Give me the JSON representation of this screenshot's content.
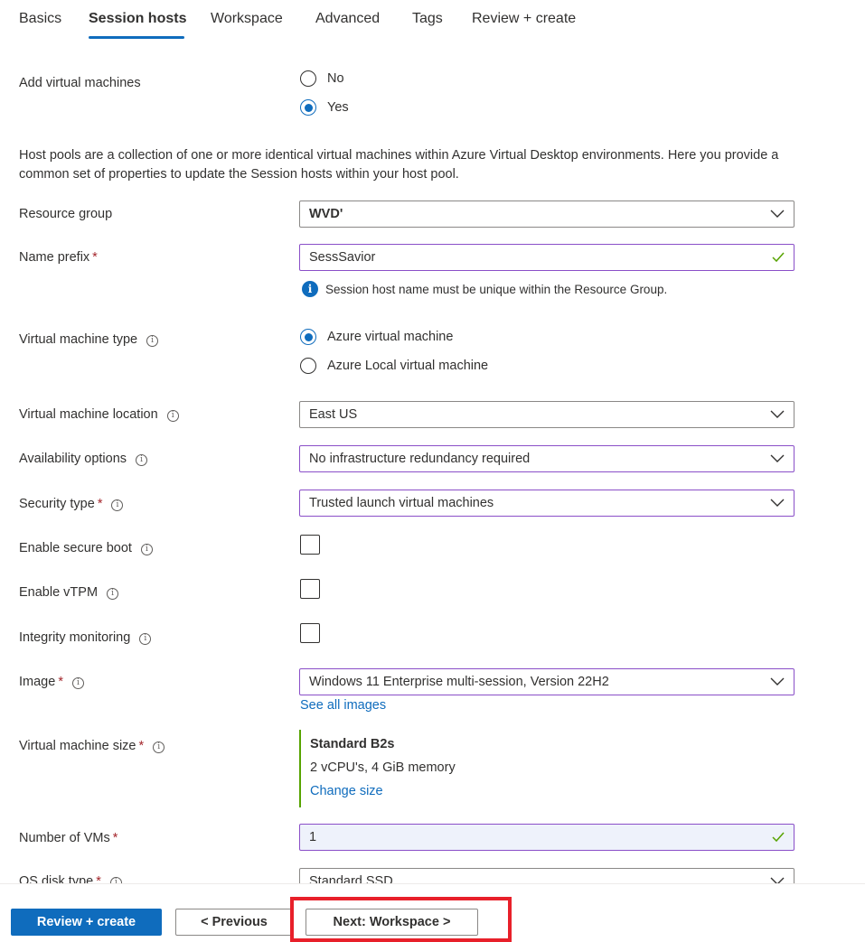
{
  "tabs": [
    {
      "label": "Basics",
      "active": false
    },
    {
      "label": "Session hosts",
      "active": true
    },
    {
      "label": "Workspace",
      "active": false
    },
    {
      "label": "Advanced",
      "active": false
    },
    {
      "label": "Tags",
      "active": false
    },
    {
      "label": "Review + create",
      "active": false
    }
  ],
  "add_vms": {
    "label": "Add virtual machines",
    "options": [
      "No",
      "Yes"
    ],
    "selected": "Yes"
  },
  "description": "Host pools are a collection of one or more identical virtual machines within Azure Virtual Desktop environments. Here you provide a common set of properties to update the Session hosts within your host pool.",
  "resource_group": {
    "label": "Resource group",
    "value": "WVD'"
  },
  "name_prefix": {
    "label": "Name prefix",
    "required": "*",
    "value": "SessSavior",
    "info": "Session host name must be unique within the Resource Group."
  },
  "vm_type": {
    "label": "Virtual machine type",
    "options": [
      "Azure virtual machine",
      "Azure Local virtual machine"
    ],
    "selected": "Azure virtual machine"
  },
  "vm_location": {
    "label": "Virtual machine location",
    "value": "East US"
  },
  "availability": {
    "label": "Availability options",
    "value": "No infrastructure redundancy required"
  },
  "security_type": {
    "label": "Security type",
    "required": "*",
    "value": "Trusted launch virtual machines"
  },
  "secure_boot": {
    "label": "Enable secure boot",
    "checked": false
  },
  "vtpm": {
    "label": "Enable vTPM",
    "checked": false
  },
  "integrity": {
    "label": "Integrity monitoring",
    "checked": false
  },
  "image": {
    "label": "Image",
    "required": "*",
    "value": "Windows 11 Enterprise multi-session, Version 22H2",
    "link": "See all images"
  },
  "vm_size": {
    "label": "Virtual machine size",
    "required": "*",
    "name": "Standard B2s",
    "detail": "2 vCPU's, 4 GiB memory",
    "link": "Change size"
  },
  "num_vms": {
    "label": "Number of VMs",
    "required": "*",
    "value": "1"
  },
  "os_disk": {
    "label": "OS disk type",
    "required": "*",
    "value": "Standard SSD"
  },
  "footer": {
    "review_create": "Review + create",
    "previous": "< Previous",
    "next": "Next: Workspace >"
  },
  "colors": {
    "accent": "#0f6cbd",
    "valid": "#57a300",
    "highlight": "#e8202a"
  }
}
